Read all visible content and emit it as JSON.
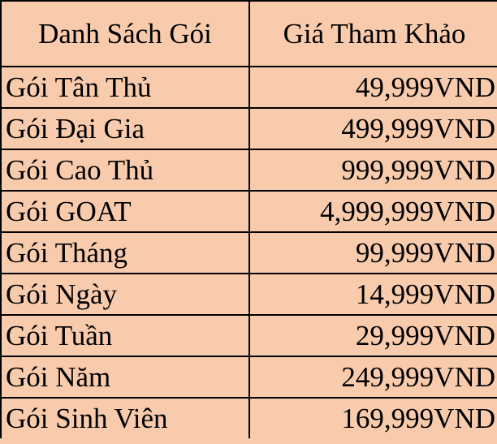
{
  "table": {
    "headers": [
      "Danh Sách Gói",
      "Giá Tham Khảo"
    ],
    "rows": [
      {
        "name": "Gói Tân Thủ",
        "price": "49,999VND"
      },
      {
        "name": "Gói Đại Gia",
        "price": "499,999VND"
      },
      {
        "name": "Gói Cao Thủ",
        "price": "999,999VND"
      },
      {
        "name": "Gói GOAT",
        "price": "4,999,999VND"
      },
      {
        "name": "Gói Tháng",
        "price": "99,999VND"
      },
      {
        "name": "Gói Ngày",
        "price": "14,999VND"
      },
      {
        "name": "Gói Tuần",
        "price": "29,999VND"
      },
      {
        "name": "Gói Năm",
        "price": "249,999VND"
      },
      {
        "name": "Gói Sinh Viên",
        "price": "169,999VND"
      }
    ]
  },
  "colors": {
    "cell_fill": "#f8cbad",
    "border": "#000000",
    "text": "#000000"
  }
}
